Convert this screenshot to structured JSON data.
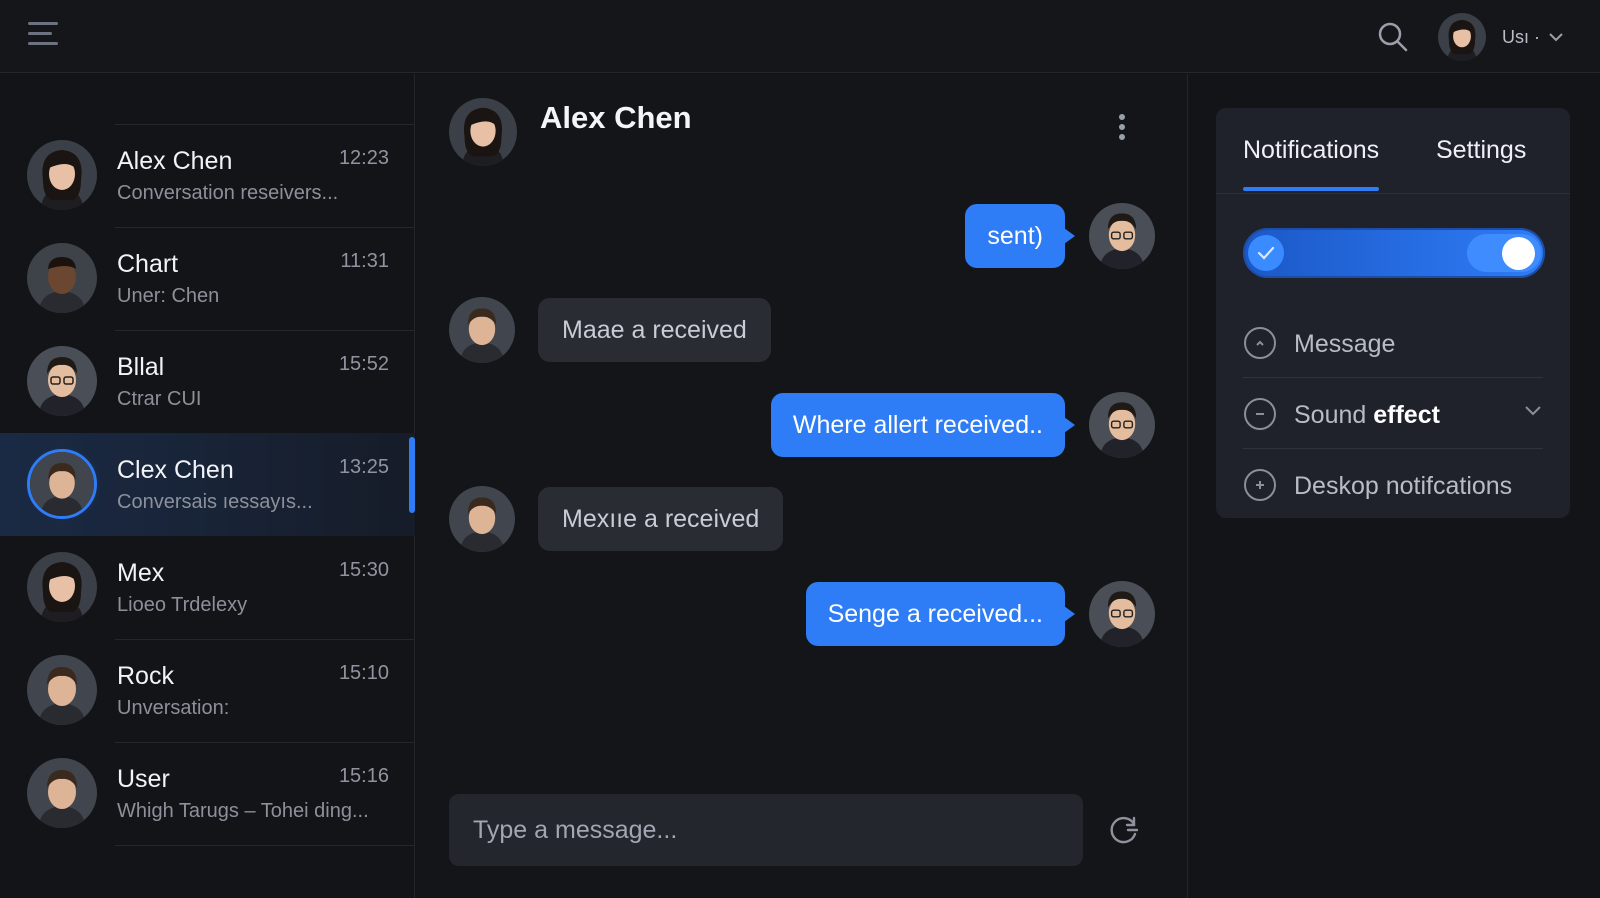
{
  "topbar": {
    "user_label": "Usı ·"
  },
  "conversations": [
    {
      "name": "Alex Chen",
      "time": "12:23",
      "preview": "Conversation reseivers...",
      "active": false
    },
    {
      "name": "Chart",
      "time": "11:31",
      "preview": "Uner: Chen",
      "active": false
    },
    {
      "name": "Bllal",
      "time": "15:52",
      "preview": "Ctrar CUI",
      "active": false
    },
    {
      "name": "Clex Chen",
      "time": "13:25",
      "preview": "Conversais ıessayıs...",
      "active": true
    },
    {
      "name": "Mex",
      "time": "15:30",
      "preview": "Lioeo Trdelexy",
      "active": false
    },
    {
      "name": "Rock",
      "time": "15:10",
      "preview": "Unversation:",
      "active": false
    },
    {
      "name": "User",
      "time": "15:16",
      "preview": "Whigh Tarugs – Tohei ding...",
      "active": false
    }
  ],
  "chat": {
    "title": "Alex Chen",
    "messages": [
      {
        "direction": "out",
        "text": "sent)"
      },
      {
        "direction": "in",
        "text": "Maae a received"
      },
      {
        "direction": "out",
        "text": "Where allert received.."
      },
      {
        "direction": "in",
        "text": "Mexııe a received"
      },
      {
        "direction": "out",
        "text": "Senge a received..."
      }
    ],
    "composer_placeholder": "Type a message..."
  },
  "panel": {
    "tabs": [
      "Notifications",
      "Settings"
    ],
    "active_tab": "Notifications",
    "toggle_on": true,
    "options": {
      "message": "Message",
      "sound_prefix": "Sound ",
      "sound_bold": "effect",
      "desktop": "Deskop notifcations"
    }
  },
  "colors": {
    "accent": "#2e7cf6",
    "background": "#131417",
    "bubble_in": "#2a2c33",
    "card": "#1f222a"
  },
  "icons": [
    "menu-icon",
    "search-icon",
    "chevron-down-icon",
    "more-vertical-icon",
    "send-icon",
    "check-icon",
    "chevron-up-circle-icon",
    "minus-circle-icon",
    "plus-circle-icon"
  ]
}
